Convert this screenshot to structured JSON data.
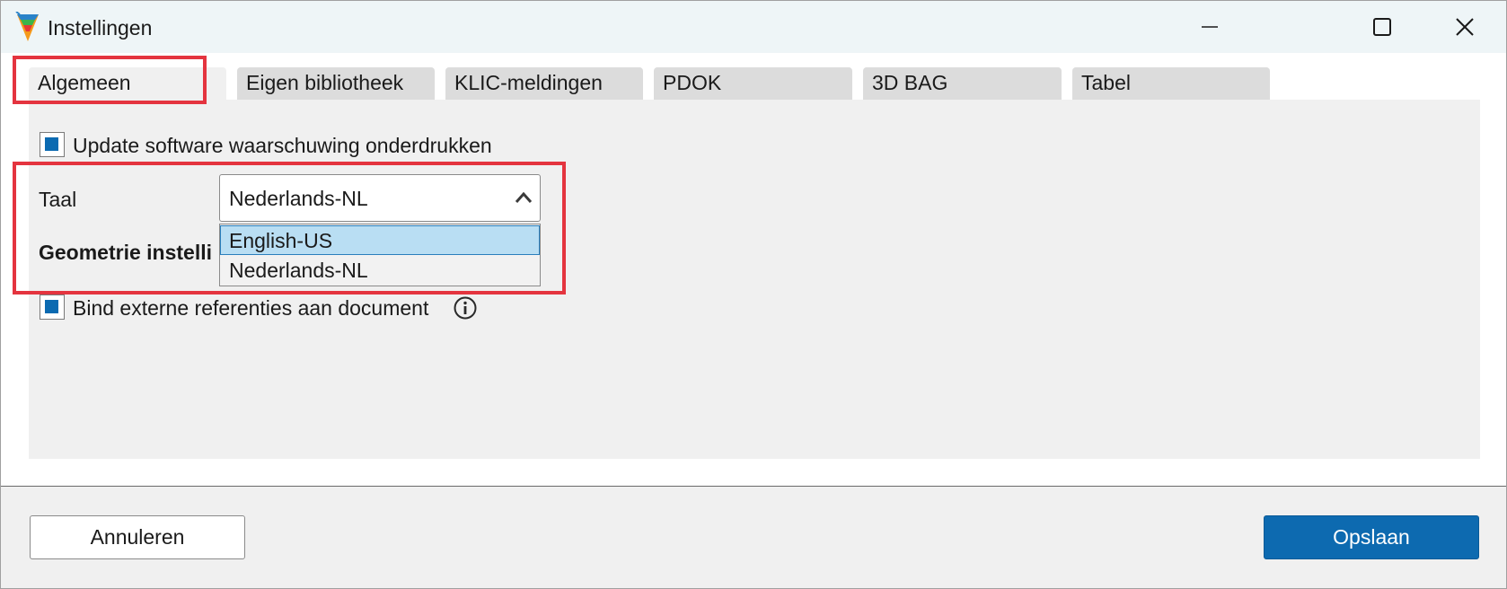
{
  "window": {
    "title": "Instellingen"
  },
  "tabs": [
    {
      "label": "Algemeen",
      "active": true
    },
    {
      "label": "Eigen bibliotheek",
      "active": false
    },
    {
      "label": "KLIC-meldingen",
      "active": false
    },
    {
      "label": "PDOK",
      "active": false
    },
    {
      "label": "3D BAG",
      "active": false
    },
    {
      "label": "Tabel",
      "active": false
    }
  ],
  "settings": {
    "update_warning_label": "Update software waarschuwing onderdrukken",
    "update_warning_checked": true,
    "language_label": "Taal",
    "language_value": "Nederlands-NL",
    "language_options": [
      "English-US",
      "Nederlands-NL"
    ],
    "language_highlighted_option": "English-US",
    "geometry_heading": "Geometrie instelli",
    "bind_refs_label": "Bind externe referenties aan document",
    "bind_refs_checked": true
  },
  "footer": {
    "cancel_label": "Annuleren",
    "save_label": "Opslaan"
  },
  "colors": {
    "accent": "#0d6ab0",
    "highlight_box": "#e4343f",
    "selected_option_bg": "#b9def3"
  },
  "icons": {
    "app": "app-logo-icon",
    "minimize": "minimize-icon",
    "maximize": "maximize-icon",
    "close": "close-icon",
    "dropdown": "chevron-up-icon",
    "info": "info-icon"
  }
}
